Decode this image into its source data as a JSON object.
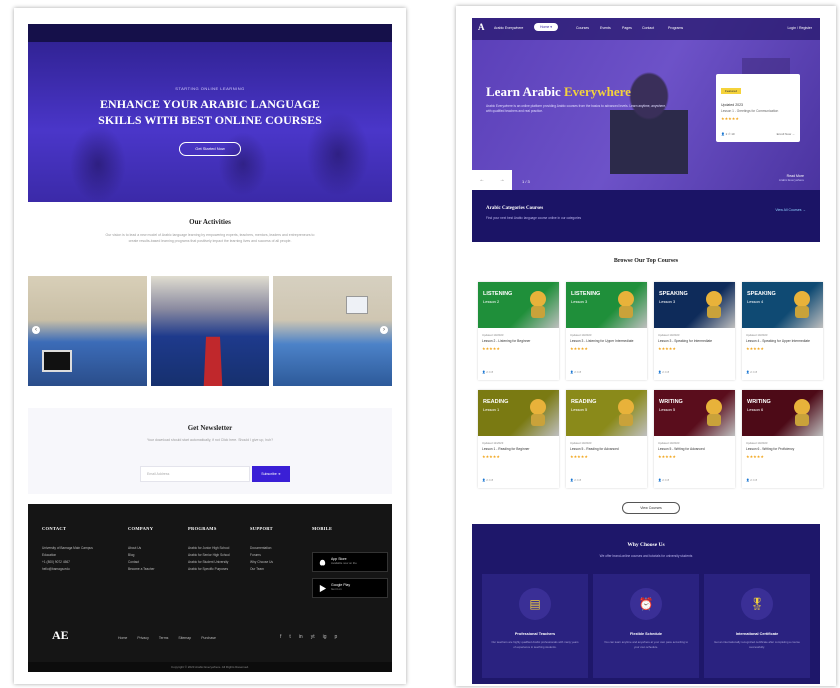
{
  "left": {
    "hero": {
      "eyebrow": "STARTING ONLINE LEARNING",
      "headline_line1": "ENHANCE YOUR ARABIC LANGUAGE",
      "headline_line2": "SKILLS WITH BEST ONLINE COURSES",
      "cta": "Get Started Now"
    },
    "activities": {
      "title": "Our Activities",
      "text": "Our vision is to lead a new model of Arabic language learning by empowering experts, teachers, mentors, leaders and entrepreneurs to create results-based learning programs that positively impact the learning lives and success of all people."
    },
    "newsletter": {
      "title": "Get Newsletter",
      "subtitle": "Your download should start automatically, if not Click here. Should I give up, huh?",
      "email_placeholder": "Email Address",
      "button": "Subscribe"
    },
    "footer": {
      "columns": [
        {
          "heading": "CONTACT",
          "items": [
            "University of Bamaga Main Campus",
            "Education",
            "+1 (800) 9072 4567",
            "hello@bamaga.edu"
          ]
        },
        {
          "heading": "COMPANY",
          "items": [
            "About Us",
            "Blog",
            "Contact",
            "Become a Teacher"
          ]
        },
        {
          "heading": "PROGRAMS",
          "items": [
            "Arabic for Junior High School",
            "Arabic for Senior High School",
            "Arabic for Student University",
            "Arabic for Specific Purposes"
          ]
        },
        {
          "heading": "SUPPORT",
          "items": [
            "Documentation",
            "Forums",
            "Why Choose Us",
            "Our Team"
          ]
        },
        {
          "heading": "MOBILE",
          "items": []
        }
      ],
      "store_app": {
        "title": "App Store",
        "sub": "Available now on the"
      },
      "store_play": {
        "title": "Google Play",
        "sub": "Get it on"
      },
      "logo": "AE",
      "links": [
        "Home",
        "Privacy",
        "Terms",
        "Sitemap",
        "Purchase"
      ],
      "social": [
        "f",
        "t",
        "in",
        "yt",
        "ig",
        "p"
      ],
      "copyright": "Copyright © 2023 Arabic Everywhere. All Rights Reserved."
    }
  },
  "right": {
    "nav": {
      "brand": "Arabic Everywhere",
      "items": [
        "Home ▾",
        "Courses",
        "Events",
        "Pages",
        "Contact",
        "Programs"
      ],
      "right": "Login / Register"
    },
    "hero": {
      "headline": "Learn Arabic",
      "headline_accent": "Everywhere",
      "lead": "Arabic Everywhere is an online platform providing Arabic courses from the basics to advanced levels. Learn anytime, anywhere, with qualified teachers and real practice.",
      "card": {
        "badge": "Featured",
        "title": "Updated 2023",
        "course": "Lesson 1 - Greetings for Communication",
        "stars": "★★★★★",
        "meta": "👤 2   ⏱ 10",
        "link": "Enroll Now →"
      },
      "counter": "1 / 3",
      "next": "Read More",
      "next_sub": "Arabic Everywhere"
    },
    "categories": {
      "title": "Arabic Categories Courses",
      "sub": "Find your next best Arabic language course online in our categories",
      "view_all": "View All Courses →"
    },
    "browse_title": "Browse Our Top Courses",
    "courses": [
      {
        "skill": "LISTENING",
        "lesson": "Lesson 2",
        "updated": "Updated 10/2023",
        "name": "Lesson 2 - Listening for Beginner",
        "color": "#1f8f3a",
        "stars": "★★★★★",
        "meta": "👤 2  ⏱ 8"
      },
      {
        "skill": "LISTENING",
        "lesson": "Lesson 3",
        "updated": "Updated 10/2023",
        "name": "Lesson 3 - Listening for Upper Intermediate",
        "color": "#1f8f3a",
        "stars": "★★★★★",
        "meta": "👤 2  ⏱ 8"
      },
      {
        "skill": "SPEAKING",
        "lesson": "Lesson 3",
        "updated": "Updated 10/2023",
        "name": "Lesson 3 - Speaking for Intermediate",
        "color": "#0e2b5a",
        "stars": "★★★★★",
        "meta": "👤 2  ⏱ 8"
      },
      {
        "skill": "SPEAKING",
        "lesson": "Lesson 4",
        "updated": "Updated 10/2023",
        "name": "Lesson 4 - Speaking for Upper Intermediate",
        "color": "#0f4a73",
        "stars": "★★★★★",
        "meta": "👤 2  ⏱ 8"
      },
      {
        "skill": "READING",
        "lesson": "Lesson 1",
        "updated": "Updated 11/2023",
        "name": "Lesson 1 - Reading for Beginner",
        "color": "#7a7a12",
        "stars": "★★★★★",
        "meta": "👤 2  ⏱ 8"
      },
      {
        "skill": "READING",
        "lesson": "Lesson 5",
        "updated": "Updated 10/2023",
        "name": "Lesson 5 - Reading for Advanced",
        "color": "#8a8a1a",
        "stars": "★★★★★",
        "meta": "👤 2  ⏱ 8"
      },
      {
        "skill": "WRITING",
        "lesson": "Lesson 5",
        "updated": "Updated 10/2023",
        "name": "Lesson 5 - Writing for Advanced",
        "color": "#5a0d1c",
        "stars": "★★★★★",
        "meta": "👤 2  ⏱ 8"
      },
      {
        "skill": "WRITING",
        "lesson": "Lesson 6",
        "updated": "Updated 10/2023",
        "name": "Lesson 6 - Writing for Proficiency",
        "color": "#4d0a17",
        "stars": "★★★★★",
        "meta": "👤 2  ⏱ 8"
      }
    ],
    "view_courses": "View Courses",
    "why": {
      "title": "Why Choose Us",
      "sub": "We offer brand-online courses and tutorials for university students",
      "boxes": [
        {
          "icon": "▤",
          "title": "Professional Teachers",
          "desc": "Our teachers are highly qualified Arabic professionals with many years of experience in teaching students."
        },
        {
          "icon": "⏰",
          "title": "Flexible Schedule",
          "desc": "You can learn anytime and anywhere at your own pace according to your own schedule."
        },
        {
          "icon": "🎖",
          "title": "International Certificate",
          "desc": "Get an internationally recognized certificate after completing a course successfully."
        }
      ]
    }
  }
}
